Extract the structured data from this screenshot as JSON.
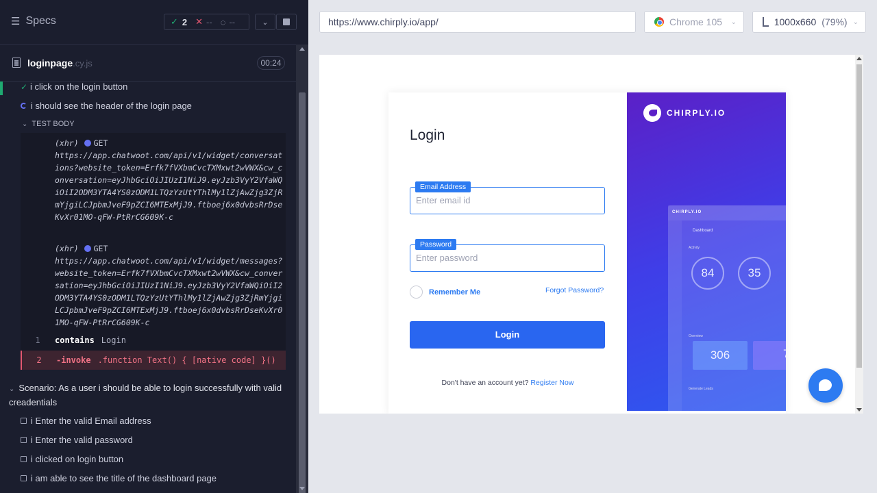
{
  "reporter": {
    "title": "Specs",
    "stats": {
      "passed": "2",
      "failed": "--",
      "pending": "--"
    },
    "file": {
      "name": "loginpage",
      "ext": ".cy.js",
      "duration": "00:24"
    },
    "tests": [
      {
        "label": "i click on the login button",
        "state": "passed"
      },
      {
        "label": "i should see the header of the login page",
        "state": "running"
      }
    ],
    "section_label": "TEST BODY",
    "commands": [
      {
        "kind": "(xhr)",
        "method": "GET",
        "url": "https://app.chatwoot.com/api/v1/widget/conversations?website_token=Erfk7fVXbmCvcTXMxwt2wVWX&cw_conversation=eyJhbGciOiJIUzI1NiJ9.eyJzb3VyY2VfaWQiOiI2ODM3YTA4YS0zODM1LTQzYzUtYThlMy1lZjAwZjg3ZjRmYjgiLCJpbmJveF9pZCI6MTExMjJ9.ftboej6x0dvbsRrDseKvXr01MO-qFW-PtRrCG609K-c"
      },
      {
        "kind": "(xhr)",
        "method": "GET",
        "url": "https://app.chatwoot.com/api/v1/widget/messages?website_token=Erfk7fVXbmCvcTXMxwt2wVWX&cw_conversation=eyJhbGciOiJIUzI1NiJ9.eyJzb3VyY2VfaWQiOiI2ODM3YTA4YS0zODM1LTQzYzUtYThlMy1lZjAwZjg3ZjRmYjgiLCJpbmJveF9pZCI6MTExMjJ9.ftboej6x0dvbsRrDseKvXr01MO-qFW-PtRrCG609K-c"
      }
    ],
    "steps": [
      {
        "num": "1",
        "name": "contains",
        "msg": "Login",
        "state": "passed"
      },
      {
        "num": "2",
        "name": "-invoke",
        "msg": ".function Text() { [native code] }()",
        "state": "failed"
      }
    ],
    "scenario": "Scenario: As a user i should be able to login successfully with valid creadentials",
    "pending_steps": [
      "i Enter the valid Email address",
      "i Enter the valid password",
      "i clicked on login button",
      "i am able to see the title of the dashboard page"
    ]
  },
  "aut": {
    "url": "https://www.chirply.io/app/",
    "browser": "Chrome 105",
    "viewport": "1000x660",
    "zoom": "(79%)",
    "login": {
      "title": "Login",
      "email_label": "Email Address",
      "email_placeholder": "Enter email id",
      "password_label": "Password",
      "password_placeholder": "Enter password",
      "remember": "Remember Me",
      "forgot": "Forgot Password?",
      "button": "Login",
      "signup_text": "Don't have an account yet?",
      "signup_link": "Register Now"
    },
    "brand": "CHIRPLY.IO",
    "mock": {
      "brand": "CHIRPLY.IO",
      "title": "Dashboard",
      "activity": "Activity",
      "gauge1": "84",
      "gauge2": "35",
      "overview": "Overview",
      "panel1": "306",
      "panel2": "7",
      "leads": "Generate Leads"
    }
  },
  "colors": {
    "pass": "#1fa971",
    "fail": "#e45770",
    "accent": "#2d7bf1",
    "running": "#6470f3"
  }
}
